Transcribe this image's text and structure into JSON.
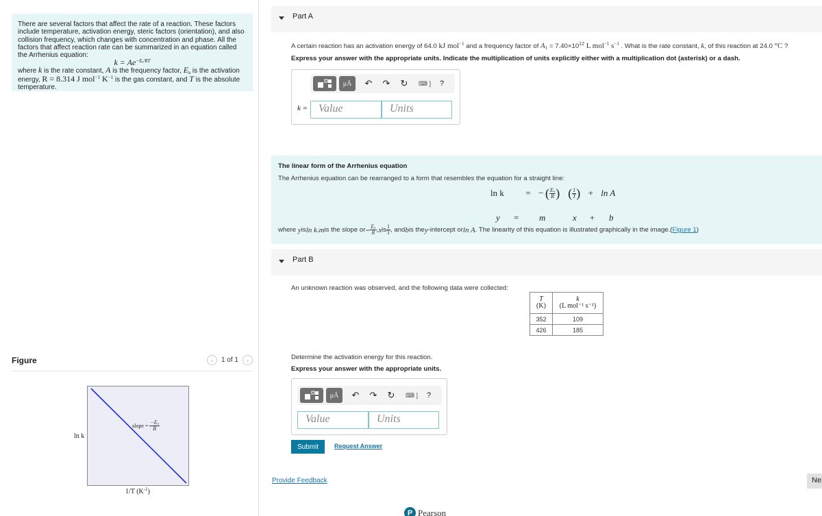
{
  "intro": {
    "paragraph": "There are several factors that affect the rate of a reaction. These factors include temperature, activation energy, steric factors (orientation), and also collision frequency, which changes with concentration and phase. All the factors that affect reaction rate can be summarized in an equation called the Arrhenius equation:",
    "equation_lhs": "k = Ae",
    "equation_exp": "−Eₐ/RT",
    "where_1": "where ",
    "k": "k",
    "where_2": " is the rate constant, ",
    "A": "A",
    "where_3": " is the frequency factor, ",
    "Ea": "E",
    "Ea_sub": "a",
    "where_4": " is the activation energy, ",
    "R_eq": "R = 8.314 J mol",
    "R_exp1": "−1",
    "R_K": " K",
    "R_exp2": "−1",
    "where_5": " is the gas constant, and ",
    "T": "T",
    "where_6": " is the absolute temperature."
  },
  "figure": {
    "title": "Figure",
    "pager_text": "1 of 1",
    "prev": "‹",
    "next": "›",
    "y_label": "ln k",
    "x_label": "1/T (K",
    "x_label_exp": "-1",
    "x_label_end": ")",
    "slope_label": "slope =",
    "slope_num": "−Eₐ",
    "slope_den": "R",
    "line_color": "#1f2ed6"
  },
  "partA": {
    "label": "Part A",
    "question_1": "A certain reaction has an activation energy of 64.0 ",
    "q_unit1": "kJ mol",
    "q_exp1": "−1",
    "question_2": " and a frequency factor of ",
    "q_A": "A",
    "q_A_sub": "1",
    "question_3": " = 7.40×10",
    "q_exp_12": "12",
    "q_unit2": " L mol",
    "q_exp2": "−1",
    "q_s": " s",
    "q_exp3": "−1",
    "question_4": " . What is the rate constant, ",
    "q_k": "k",
    "question_5": ", of this reaction at 24.0 ",
    "q_unit3": "°C",
    "question_6": " ?",
    "instruction": "Express your answer with the appropriate units.  Indicate the multiplication of units explicitly either with a multiplication dot (asterisk) or a dash.",
    "input_label": "k =",
    "value_placeholder": "Value",
    "units_placeholder": "Units"
  },
  "toolbar": {
    "units_button": "μÅ",
    "undo": "↶",
    "redo": "↷",
    "reset": "↻",
    "keyboard": "⌨ ]",
    "help": "?"
  },
  "linear": {
    "title": "The linear form of the Arrhenius equation",
    "intro": "The Arrhenius equation can be rearranged to a form that resembles the equation for a straight line:",
    "eq_lnk": "ln k",
    "eq_eq": "=",
    "eq_minus": "−",
    "eq_Ea": "Eₐ",
    "eq_R": "R",
    "eq_one": "1",
    "eq_T": "T",
    "eq_plus": "+",
    "eq_lnA": "ln A",
    "y": "y",
    "m": "m",
    "x": "x",
    "b": "b",
    "where_a": "where ",
    "where_y": "y",
    "where_b": " is ",
    "where_lnk": "ln k",
    "where_c": ", ",
    "where_m": "m",
    "where_d": " is the slope or ",
    "where_frac_num": "Eₐ",
    "where_frac_den": "R",
    "where_e": ", ",
    "where_x": "x",
    "where_f": " is ",
    "where_one": "1",
    "where_T": "T",
    "where_g": ", and ",
    "where_bvar": "b",
    "where_h": " is the ",
    "where_yvar": "y",
    "where_i": "-intercept or ",
    "where_lnA": "ln A",
    "where_j": ". The linearity of this equation is illustrated graphically in the image.(",
    "figure_link": "Figure 1",
    "where_k": ")"
  },
  "partB": {
    "label": "Part B",
    "intro": "An unknown reaction was observed, and the following data were collected:",
    "table": {
      "headers": [
        {
          "var": "T",
          "unit": "(K)"
        },
        {
          "var": "k",
          "unit": "(L mol⁻¹ s⁻¹)"
        }
      ],
      "rows": [
        [
          "352",
          "109"
        ],
        [
          "426",
          "185"
        ]
      ]
    },
    "question": "Determine the activation energy for this reaction.",
    "instruction": "Express your answer with the appropriate units.",
    "value_placeholder": "Value",
    "units_placeholder": "Units",
    "submit": "Submit",
    "request_answer": "Request Answer"
  },
  "footer": {
    "feedback": "Provide Feedback",
    "next": "Ne",
    "brand": "Pearson",
    "brand_logo": "P"
  }
}
